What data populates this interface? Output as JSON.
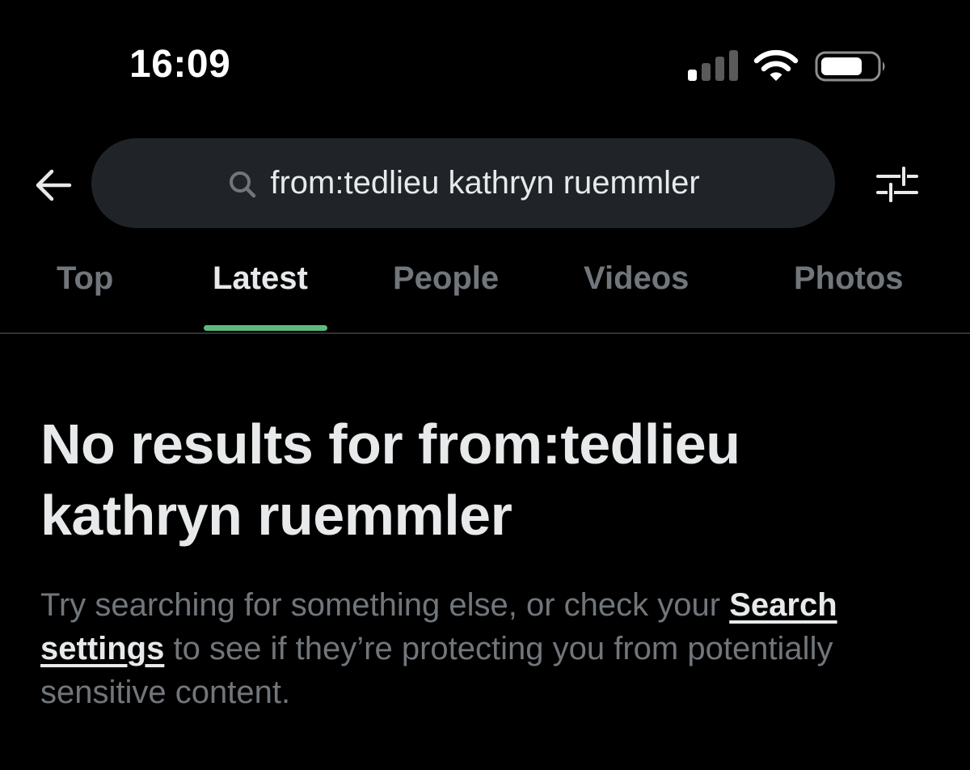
{
  "status_bar": {
    "time": "16:09",
    "icons": [
      "cellular-signal-icon",
      "wifi-icon",
      "battery-icon"
    ]
  },
  "search": {
    "query": "from:tedlieu kathryn ruemmler",
    "icons": {
      "back": "arrow-left-icon",
      "search": "search-icon",
      "filter": "sliders-icon"
    }
  },
  "tabs": [
    {
      "label": "Top"
    },
    {
      "label": "Latest",
      "active": true
    },
    {
      "label": "People"
    },
    {
      "label": "Videos"
    },
    {
      "label": "Photos"
    }
  ],
  "empty_state": {
    "title": "No results for from:tedlieu kathryn ruemmler",
    "body_before": "Try searching for something else, or check your ",
    "link": "Search settings",
    "body_after": " to see if they’re protecting you from potentially sensitive content."
  },
  "colors": {
    "background": "#000000",
    "search_box": "#202327",
    "active_indicator": "#5dba7c",
    "muted_text": "#71767b",
    "primary_text": "#e7e9ea"
  }
}
